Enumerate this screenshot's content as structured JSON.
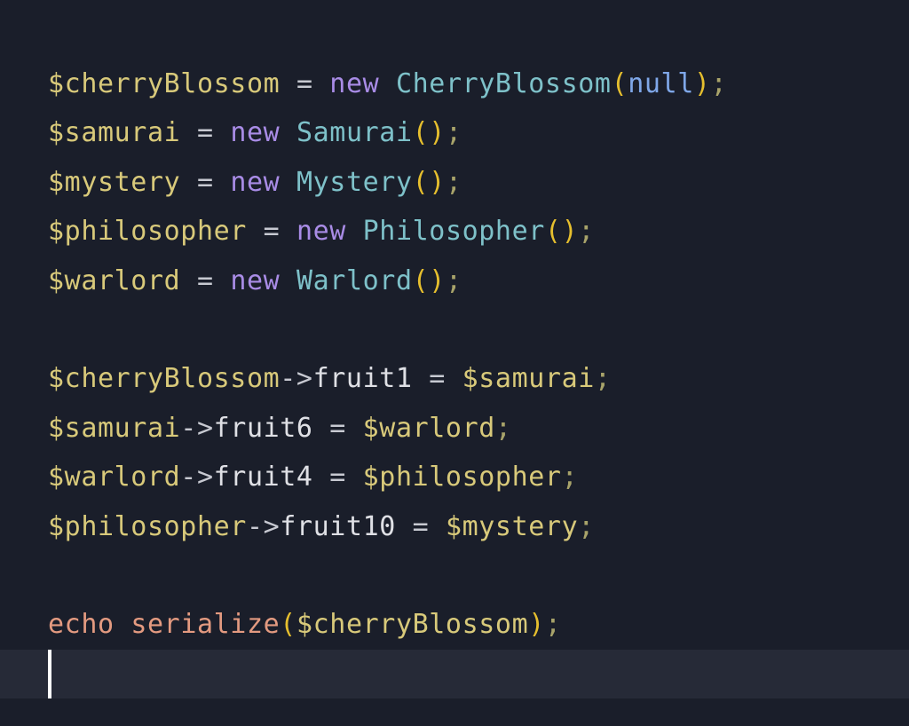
{
  "colors": {
    "background": "#1a1e2a",
    "current_line": "#262a37",
    "variable": "#d8c97a",
    "operator": "#c7c9d1",
    "keyword": "#a98ce6",
    "class_name": "#7ec1c9",
    "paren": "#e6bf2e",
    "null": "#7fa7e8",
    "property": "#dfe0e5",
    "function": "#e39a80",
    "cursor": "#ffffff"
  },
  "tokens": {
    "eq": "=",
    "arrow": "->",
    "new": "new",
    "open": "(",
    "close": ")",
    "semi": ";",
    "null": "null",
    "echo": "echo",
    "serialize": "serialize"
  },
  "lines": [
    {
      "var": "$cherryBlossom",
      "class": "CherryBlossom"
    },
    {
      "var": "$samurai",
      "class": "Samurai"
    },
    {
      "var": "$mystery",
      "class": "Mystery"
    },
    {
      "var": "$philosopher",
      "class": "Philosopher"
    },
    {
      "var": "$warlord",
      "class": "Warlord"
    }
  ],
  "assignments": [
    {
      "target": "$cherryBlossom",
      "prop": "fruit1",
      "value": "$samurai"
    },
    {
      "target": "$samurai",
      "prop": "fruit6",
      "value": "$warlord"
    },
    {
      "target": "$warlord",
      "prop": "fruit4",
      "value": "$philosopher"
    },
    {
      "target": "$philosopher",
      "prop": "fruit10",
      "value": "$mystery"
    }
  ],
  "echo_arg": "$cherryBlossom"
}
